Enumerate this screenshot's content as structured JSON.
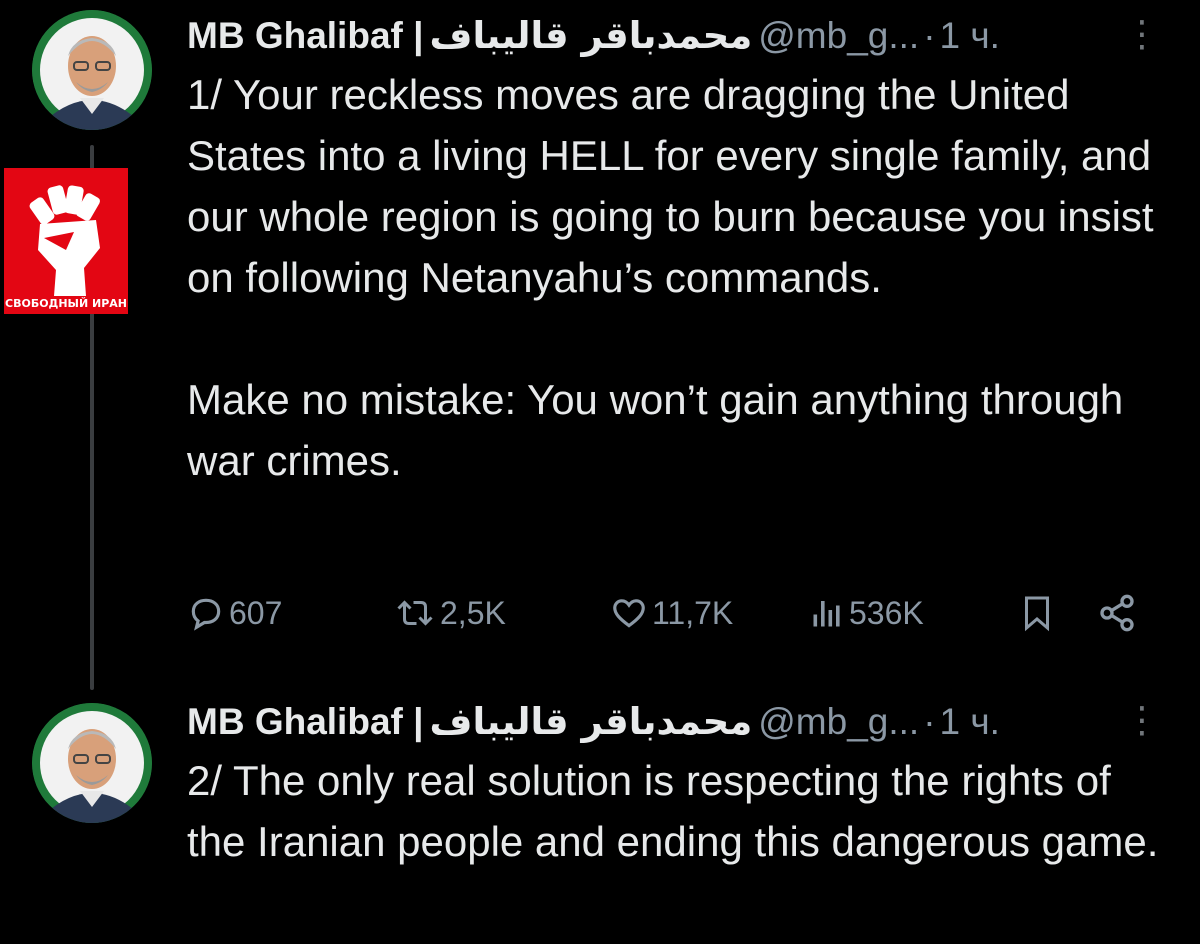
{
  "tweets": [
    {
      "display_name": "MB Ghalibaf |",
      "arabic_name": "محمدباقر قالیباف",
      "handle": "@mb_g...",
      "separator": "·",
      "time": "1 ч.",
      "more_label": "⋮",
      "paragraphs": [
        "1/ Your reckless moves are dragging the United States into a living HELL for every single family, and our whole region is going to burn because you insist on following Netanyahu’s commands.",
        "Make no mistake: You won’t gain anything through war crimes."
      ],
      "actions": {
        "replies": "607",
        "reposts": "2,5K",
        "likes": "11,7K",
        "views": "536K"
      }
    },
    {
      "display_name": "MB Ghalibaf |",
      "arabic_name": "محمدباقر قالیباف",
      "handle": "@mb_g...",
      "separator": "·",
      "time": "1 ч.",
      "more_label": "⋮",
      "paragraphs": [
        "2/ The only real solution is respecting the rights of the Iranian people and ending this dangerous game."
      ]
    }
  ],
  "watermark": {
    "caption": "СВОБОДНЫЙ ИРАН",
    "icon": "raised-fist-icon",
    "color": "#e30613"
  },
  "colors": {
    "background": "#000000",
    "text": "#e7e9ea",
    "muted": "#8b98a5",
    "thread_line": "#3a3d40"
  }
}
